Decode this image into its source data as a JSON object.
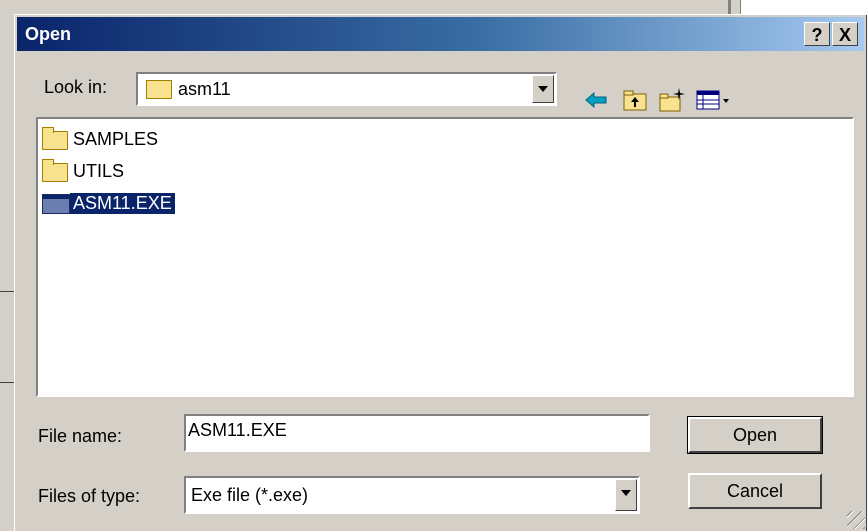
{
  "dialog": {
    "title": "Open",
    "help_label": "?",
    "close_label": "X"
  },
  "look_in": {
    "label": "Look in:",
    "value": "asm11",
    "icon": "folder-open-icon"
  },
  "toolbar": {
    "icons": [
      "back-arrow-icon",
      "up-folder-icon",
      "new-folder-icon",
      "view-menu-icon"
    ]
  },
  "files": [
    {
      "name": "SAMPLES",
      "icon": "folder-icon",
      "selected": false
    },
    {
      "name": "UTILS",
      "icon": "folder-icon",
      "selected": false
    },
    {
      "name": "ASM11.EXE",
      "icon": "exe-icon",
      "selected": true
    }
  ],
  "file_name": {
    "label": "File name:",
    "value": "ASM11.EXE"
  },
  "files_of_type": {
    "label": "Files of type:",
    "value": "Exe file (*.exe)"
  },
  "buttons": {
    "open": "Open",
    "cancel": "Cancel"
  },
  "colors": {
    "title_start": "#0a246a",
    "title_end": "#a6caf0",
    "selection": "#0a246a",
    "face": "#d4d0c8"
  }
}
